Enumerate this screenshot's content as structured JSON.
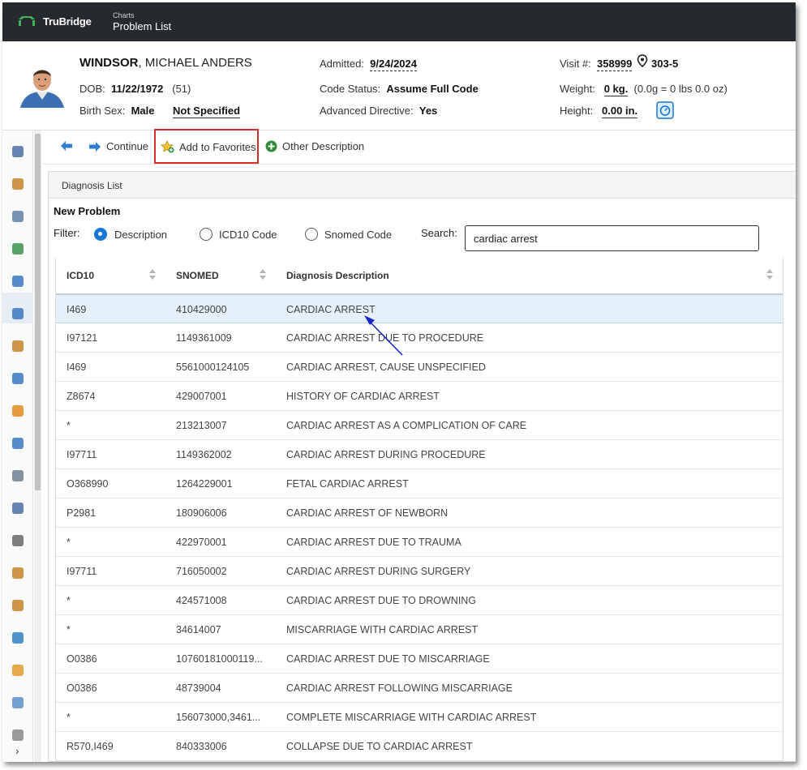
{
  "topbar": {
    "brand": "TruBridge",
    "crumb_small": "Charts",
    "crumb_title": "Problem List"
  },
  "patient": {
    "last_name": "WINDSOR",
    "first_name": ", MICHAEL ANDERS",
    "dob_label": "DOB:",
    "dob": "11/22/1972",
    "age": "(51)",
    "birth_sex_label": "Birth Sex:",
    "birth_sex": "Male",
    "gender": "Not Specified",
    "admitted_label": "Admitted:",
    "admitted": "9/24/2024",
    "code_status_label": "Code Status:",
    "code_status": "Assume Full Code",
    "directive_label": "Advanced Directive:",
    "directive": "Yes",
    "visit_label": "Visit #:",
    "visit": "358999",
    "room": "303-5",
    "weight_label": "Weight:",
    "weight": "0 kg.",
    "weight_note": "(0.0g = 0 lbs 0.0 oz)",
    "height_label": "Height:",
    "height": "0.00 in."
  },
  "toolbar": {
    "continue_label": "Continue",
    "favorites_label": "Add to Favorites",
    "other_label": "Other Description"
  },
  "panel": {
    "title": "Diagnosis List",
    "new_problem": "New Problem",
    "filter_label": "Filter:",
    "filter_options": [
      "Description",
      "ICD10 Code",
      "Snomed Code"
    ],
    "selected_filter": "Description",
    "search_label": "Search:",
    "search_value": "cardiac arrest"
  },
  "table": {
    "columns": [
      "ICD10",
      "SNOMED",
      "Diagnosis Description"
    ],
    "rows": [
      {
        "icd10": "I469",
        "snomed": "410429000",
        "desc": "CARDIAC ARREST"
      },
      {
        "icd10": "I97121",
        "snomed": "1149361009",
        "desc": "CARDIAC ARREST DUE TO PROCEDURE"
      },
      {
        "icd10": "I469",
        "snomed": "5561000124105",
        "desc": "CARDIAC ARREST, CAUSE UNSPECIFIED"
      },
      {
        "icd10": "Z8674",
        "snomed": "429007001",
        "desc": "HISTORY OF CARDIAC ARREST"
      },
      {
        "icd10": "*",
        "snomed": "213213007",
        "desc": "CARDIAC ARREST AS A COMPLICATION OF CARE"
      },
      {
        "icd10": "I97711",
        "snomed": "1149362002",
        "desc": "CARDIAC ARREST DURING PROCEDURE"
      },
      {
        "icd10": "O368990",
        "snomed": "1264229001",
        "desc": "FETAL CARDIAC ARREST"
      },
      {
        "icd10": "P2981",
        "snomed": "180906006",
        "desc": "CARDIAC ARREST OF NEWBORN"
      },
      {
        "icd10": "*",
        "snomed": "422970001",
        "desc": "CARDIAC ARREST DUE TO TRAUMA"
      },
      {
        "icd10": "I97711",
        "snomed": "716050002",
        "desc": "CARDIAC ARREST DURING SURGERY"
      },
      {
        "icd10": "*",
        "snomed": "424571008",
        "desc": "CARDIAC ARREST DUE TO DROWNING"
      },
      {
        "icd10": "*",
        "snomed": "34614007",
        "desc": "MISCARRIAGE WITH CARDIAC ARREST"
      },
      {
        "icd10": "O0386",
        "snomed": "10760181000119...",
        "desc": "CARDIAC ARREST DUE TO MISCARRIAGE"
      },
      {
        "icd10": "O0386",
        "snomed": "48739004",
        "desc": "CARDIAC ARREST FOLLOWING MISCARRIAGE"
      },
      {
        "icd10": "*",
        "snomed": "156073000,3461...",
        "desc": "COMPLETE MISCARRIAGE WITH CARDIAC ARREST"
      },
      {
        "icd10": "R570,I469",
        "snomed": "840333006",
        "desc": "COLLAPSE DUE TO CARDIAC ARREST"
      }
    ],
    "selected_row": 0
  },
  "rail": {
    "icons": [
      "database-icon",
      "users-icon",
      "document-icon",
      "globe-check-icon",
      "clipboard-edit-icon",
      "checklist-icon",
      "people-chat-icon",
      "calendar-list-icon",
      "alert-icon",
      "person-globe-icon",
      "stack-icon",
      "file-list-icon",
      "phone-icon",
      "person-icon",
      "users-chat-icon",
      "world-icon",
      "medical-folder-icon",
      "flask-icon",
      "edit-icon"
    ],
    "colors": [
      "#4a6fa5",
      "#c9822a",
      "#5d7fa8",
      "#3c8f4c",
      "#3a78c2",
      "#3a78c2",
      "#c9822a",
      "#3a78c2",
      "#e08a1c",
      "#3a78c2",
      "#6f7f8f",
      "#4a6fa5",
      "#666666",
      "#c9822a",
      "#c9822a",
      "#2e7fbf",
      "#e39a2e",
      "#5b8fc9",
      "#888888"
    ],
    "active_index": 5
  },
  "colors": {
    "topbar": "#262a2e",
    "accent": "#1877d2",
    "selected_row": "#e6f0fa",
    "highlight_box": "#d32f2f",
    "annotation_arrow": "#1a24c9"
  }
}
